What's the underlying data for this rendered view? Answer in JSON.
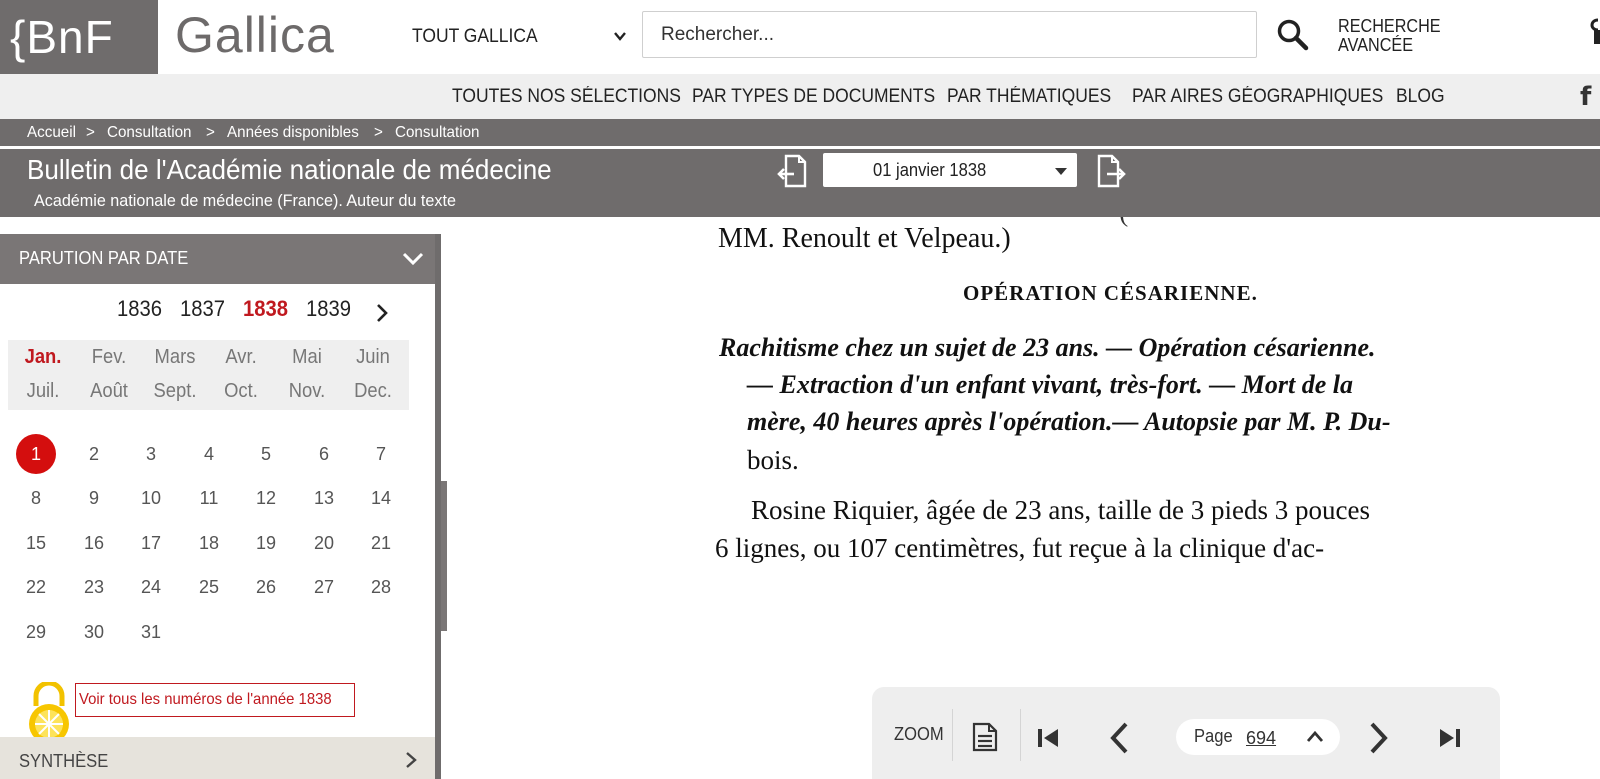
{
  "header": {
    "logo_bnf": "{BnF",
    "logo_gallica": "Gallica",
    "scope_label": "TOUT GALLICA",
    "search_placeholder": "Rechercher...",
    "advanced_line1": "RECHERCHE",
    "advanced_line2": "AVANCÉE"
  },
  "nav": {
    "items": [
      "TOUTES NOS SÉLECTIONS",
      "PAR TYPES DE DOCUMENTS",
      "PAR THÉMATIQUES",
      "PAR AIRES GÉOGRAPHIQUES",
      "BLOG"
    ],
    "facebook": "f"
  },
  "breadcrumb": [
    {
      "label": "Accueil",
      "sep": ">"
    },
    {
      "label": "Consultation",
      "sep": ">"
    },
    {
      "label": "Années disponibles",
      "sep": ">"
    },
    {
      "label": "Consultation",
      "sep": ""
    }
  ],
  "document_header": {
    "title": "Bulletin de l'Académie nationale de médecine",
    "author": "Académie nationale de médecine (France). Auteur du texte",
    "issue_selected": "01 janvier 1838"
  },
  "panel": {
    "heading": "PARUTION PAR DATE",
    "years": [
      "1836",
      "1837",
      "1838",
      "1839"
    ],
    "active_year": "1838",
    "months": [
      "Jan.",
      "Fev.",
      "Mars",
      "Avr.",
      "Mai",
      "Juin",
      "Juil.",
      "Août",
      "Sept.",
      "Oct.",
      "Nov.",
      "Dec."
    ],
    "active_month": "Jan.",
    "days": [
      "1",
      "2",
      "3",
      "4",
      "5",
      "6",
      "7",
      "8",
      "9",
      "10",
      "11",
      "12",
      "13",
      "14",
      "15",
      "16",
      "17",
      "18",
      "19",
      "20",
      "21",
      "22",
      "23",
      "24",
      "25",
      "26",
      "27",
      "28",
      "29",
      "30",
      "31"
    ],
    "active_day": "1",
    "all_issues_link": "Voir tous les numéros de l'année 1838",
    "next_section": "SYNTHÈSE"
  },
  "scan_text": {
    "line_mm": "MM. Renoult et Velpeau.)",
    "heading": "OPÉRATION CÉSARIENNE.",
    "it1": "Rachitisme chez un sujet de 23 ans. — Opération césarienne.",
    "it2": "— Extraction d'un enfant vivant, très-fort. — Mort de la",
    "it3": "mère, 40 heures après l'opération.— Autopsie par M. P. Du-",
    "it4": "bois.",
    "p1": "Rosine Riquier, âgée de 23 ans, taille de 3 pieds 3 pouces",
    "p2": "6 lignes, ou 107 centimètres, fut reçue à la clinique d'ac-"
  },
  "viewer": {
    "zoom_label": "ZOOM",
    "page_label": "Page",
    "page_value": "694"
  },
  "colors": {
    "bnf_grey": "#6f6c6c",
    "accent_red": "#c0191f",
    "nav_bg": "#efefef"
  }
}
